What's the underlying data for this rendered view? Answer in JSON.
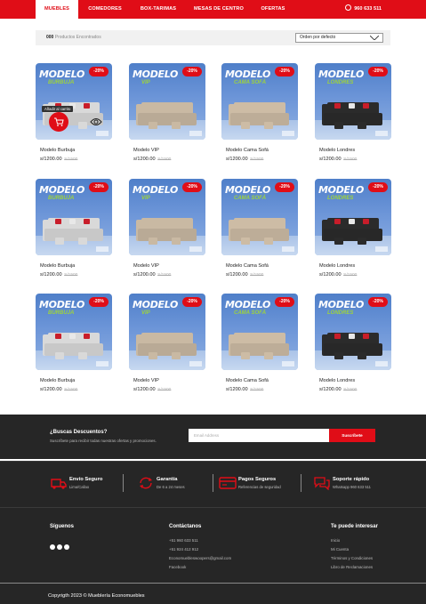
{
  "nav": {
    "items": [
      {
        "label": "MUEBLES",
        "active": true
      },
      {
        "label": "COMEDORES",
        "active": false
      },
      {
        "label": "BOX-TARIMAS",
        "active": false
      },
      {
        "label": "MESAS DE CENTRO",
        "active": false
      },
      {
        "label": "OFERTAS",
        "active": false
      }
    ],
    "phone": "960 633 511",
    "phone_icon": "whatsapp-icon"
  },
  "toolbar": {
    "count_number": "000",
    "count_label": "Productos Encontrados",
    "sort_selected": "Orden por defecto"
  },
  "products": [
    {
      "image_title": "MODELO",
      "image_subtitle": "BURBUJA",
      "discount": "-20%",
      "name": "Modelo Burbuja",
      "price": "s/1200.00",
      "old_price": "S/1500",
      "fabric": "#d9d9d9",
      "pillow": true,
      "hover": true,
      "hover_label": "Añadir al carrito"
    },
    {
      "image_title": "MODELO",
      "image_subtitle": "VIP",
      "discount": "-20%",
      "name": "Modelo VIP",
      "price": "s/1200.00",
      "old_price": "S/1500",
      "fabric": "#c9b9a3",
      "pillow": false,
      "hover": false
    },
    {
      "image_title": "MODELO",
      "image_subtitle": "CAMA SOFÁ",
      "discount": "-20%",
      "name": "Modelo Cama Sofá",
      "price": "s/1200.00",
      "old_price": "S/1500",
      "fabric": "#cdbca5",
      "pillow": false,
      "hover": false
    },
    {
      "image_title": "MODELO",
      "image_subtitle": "LONDRES",
      "discount": "-20%",
      "name": "Modelo Londres",
      "price": "s/1200.00",
      "old_price": "S/1500",
      "fabric": "#2b2b2b",
      "pillow": true,
      "hover": false
    },
    {
      "image_title": "MODELO",
      "image_subtitle": "BURBUJA",
      "discount": "-20%",
      "name": "Modelo Burbuja",
      "price": "s/1200.00",
      "old_price": "S/1500",
      "fabric": "#d9d9d9",
      "pillow": true,
      "hover": false
    },
    {
      "image_title": "MODELO",
      "image_subtitle": "VIP",
      "discount": "-20%",
      "name": "Modelo VIP",
      "price": "s/1200.00",
      "old_price": "S/1500",
      "fabric": "#c9b9a3",
      "pillow": false,
      "hover": false
    },
    {
      "image_title": "MODELO",
      "image_subtitle": "CAMA SOFÁ",
      "discount": "-20%",
      "name": "Modelo Cama Sofá",
      "price": "s/1200.00",
      "old_price": "S/1500",
      "fabric": "#cdbca5",
      "pillow": false,
      "hover": false
    },
    {
      "image_title": "MODELO",
      "image_subtitle": "LONDRES",
      "discount": "-20%",
      "name": "Modelo Londres",
      "price": "s/1200.00",
      "old_price": "S/1500",
      "fabric": "#2b2b2b",
      "pillow": true,
      "hover": false
    },
    {
      "image_title": "MODELO",
      "image_subtitle": "BURBUJA",
      "discount": "-20%",
      "name": "Modelo Burbuja",
      "price": "s/1200.00",
      "old_price": "S/1500",
      "fabric": "#d9d9d9",
      "pillow": true,
      "hover": false
    },
    {
      "image_title": "MODELO",
      "image_subtitle": "VIP",
      "discount": "-20%",
      "name": "Modelo VIP",
      "price": "s/1200.00",
      "old_price": "S/1500",
      "fabric": "#c9b9a3",
      "pillow": false,
      "hover": false
    },
    {
      "image_title": "MODELO",
      "image_subtitle": "CAMA SOFÁ",
      "discount": "-20%",
      "name": "Modelo Cama Sofá",
      "price": "s/1200.00",
      "old_price": "S/1500",
      "fabric": "#cdbca5",
      "pillow": false,
      "hover": false
    },
    {
      "image_title": "MODELO",
      "image_subtitle": "LONDRES",
      "discount": "-20%",
      "name": "Modelo Londres",
      "price": "s/1200.00",
      "old_price": "S/1500",
      "fabric": "#2b2b2b",
      "pillow": true,
      "hover": false
    }
  ],
  "newsletter": {
    "title": "¿Buscas Descuentos?",
    "subtitle": "Suscríbete para recibir todas nuestras ofertas y promociones.",
    "input_placeholder": "Email Address",
    "button_label": "Suscríbete"
  },
  "features": [
    {
      "icon": "truck-icon",
      "title": "Envío Seguro",
      "subtitle": "Lima/Callao"
    },
    {
      "icon": "refresh-icon",
      "title": "Garantía",
      "subtitle": "De 6 a 24 meses"
    },
    {
      "icon": "credit-card-icon",
      "title": "Pagos Seguros",
      "subtitle": "Referencias de seguridad"
    },
    {
      "icon": "chat-icon",
      "title": "Soporte rápido",
      "subtitle": "Whatsapp 960 633 511"
    }
  ],
  "footer": {
    "follow_title": "Síguenos",
    "social_icons": [
      "facebook-icon",
      "instagram-icon",
      "twitter-icon"
    ],
    "contact_title": "Contáctanos",
    "contact_lines": [
      "+51 960 633 511",
      "+51 924 412 912",
      "Economuebleswoopers@gmail.com",
      "Facebook"
    ],
    "interest_title": "Te puede interesar",
    "interest_links": [
      "Inicio",
      "Mi Cuenta",
      "Términos y Condiciones",
      "Libro de Reclamaciones"
    ],
    "copyright": "Copyrigth 2023 © Mueblería Economuebles"
  },
  "colors": {
    "brand": "#e00d17",
    "dark": "#262626",
    "toolbar_bg": "#f1f1f1"
  }
}
